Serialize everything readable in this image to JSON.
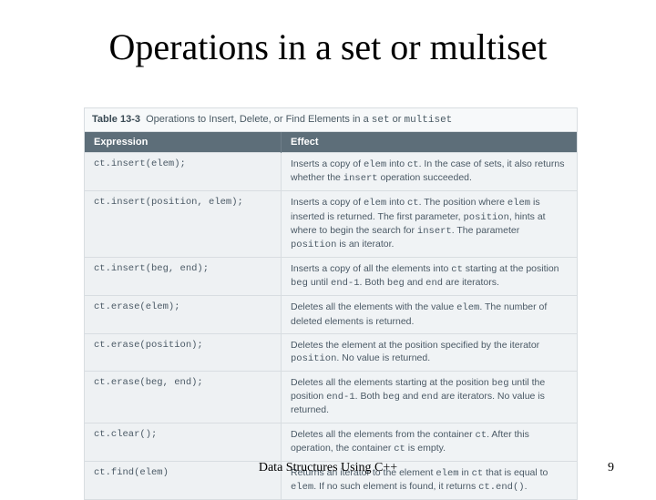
{
  "title": "Operations in a set or multiset",
  "footer": {
    "center": "Data Structures Using C++",
    "page": "9"
  },
  "table": {
    "caption_num": "Table 13-3",
    "caption_text": "Operations to Insert, Delete, or Find Elements in a ",
    "caption_tail": "set",
    "caption_or": " or ",
    "caption_tail2": "multiset",
    "headers": [
      "Expression",
      "Effect"
    ],
    "rows": [
      {
        "expr": "ct.insert(elem);",
        "effect_html": "Inserts a copy of <code>elem</code> into <code>ct</code>. In the case of sets, it also returns whether the <code>insert</code> operation succeeded."
      },
      {
        "expr": "ct.insert(position, elem);",
        "effect_html": "Inserts a copy of <code>elem</code> into <code>ct</code>. The position where <code>elem</code> is inserted is returned. The first parameter, <code>position</code>, hints at where to begin the search for <code>insert</code>. The parameter <code>position</code> is an iterator."
      },
      {
        "expr": "ct.insert(beg, end);",
        "effect_html": "Inserts a copy of all the elements into <code>ct</code> starting at the position <code>beg</code> until <code>end-1</code>. Both <code>beg</code> and <code>end</code> are iterators."
      },
      {
        "expr": "ct.erase(elem);",
        "effect_html": "Deletes all the elements with the value <code>elem</code>. The number of deleted elements is returned."
      },
      {
        "expr": "ct.erase(position);",
        "effect_html": "Deletes the element at the position specified by the iterator <code>position</code>. No value is returned."
      },
      {
        "expr": "ct.erase(beg, end);",
        "effect_html": "Deletes all the elements starting at the position <code>beg</code> until the position <code>end-1</code>. Both <code>beg</code> and <code>end</code> are iterators. No value is returned."
      },
      {
        "expr": "ct.clear();",
        "effect_html": "Deletes all the elements from the container <code>ct</code>. After this operation, the container <code>ct</code> is empty."
      },
      {
        "expr": "ct.find(elem)",
        "effect_html": "Returns an iterator to the element <code>elem</code> in <code>ct</code> that is equal to <code>elem</code>. If no such element is found, it returns <code>ct.end()</code>."
      }
    ]
  }
}
